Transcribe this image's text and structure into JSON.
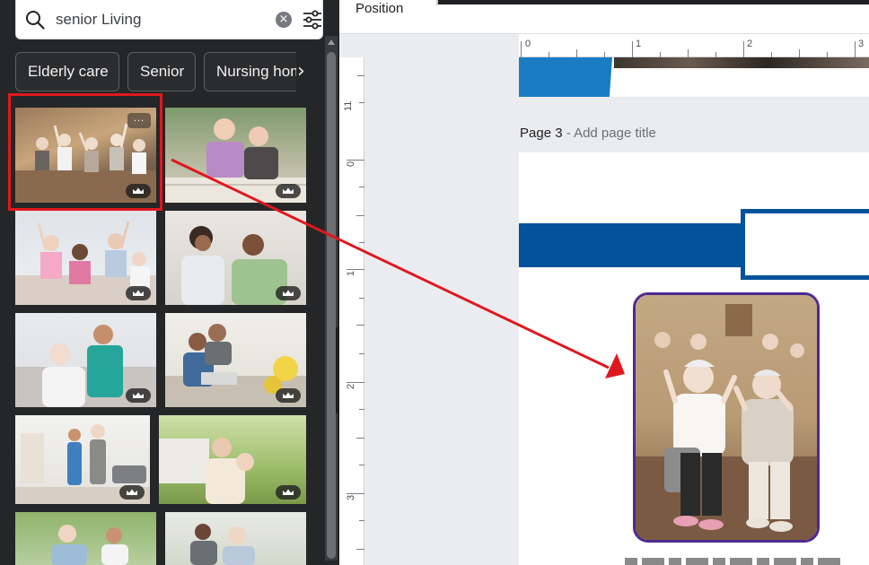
{
  "search": {
    "query": "senior Living",
    "clear_icon": "close-icon",
    "filter_icon": "filter-icon"
  },
  "chips": [
    "Elderly care",
    "Senior",
    "Nursing home"
  ],
  "topbar": {
    "label": "Position"
  },
  "rulers": {
    "top": [
      "0",
      "1",
      "2",
      "3"
    ],
    "left": [
      "11",
      "0",
      "1",
      "2",
      "3"
    ]
  },
  "page": {
    "number_label": "Page 3",
    "separator": " - ",
    "title_placeholder": "Add page title"
  },
  "colors": {
    "accent_blue": "#02529c",
    "selection_red": "#e0181e",
    "frame_purple": "#4d2a8f"
  },
  "icons": {
    "premium": "crown-icon",
    "more": "more-options-icon",
    "collapse": "chevron-left-icon"
  }
}
